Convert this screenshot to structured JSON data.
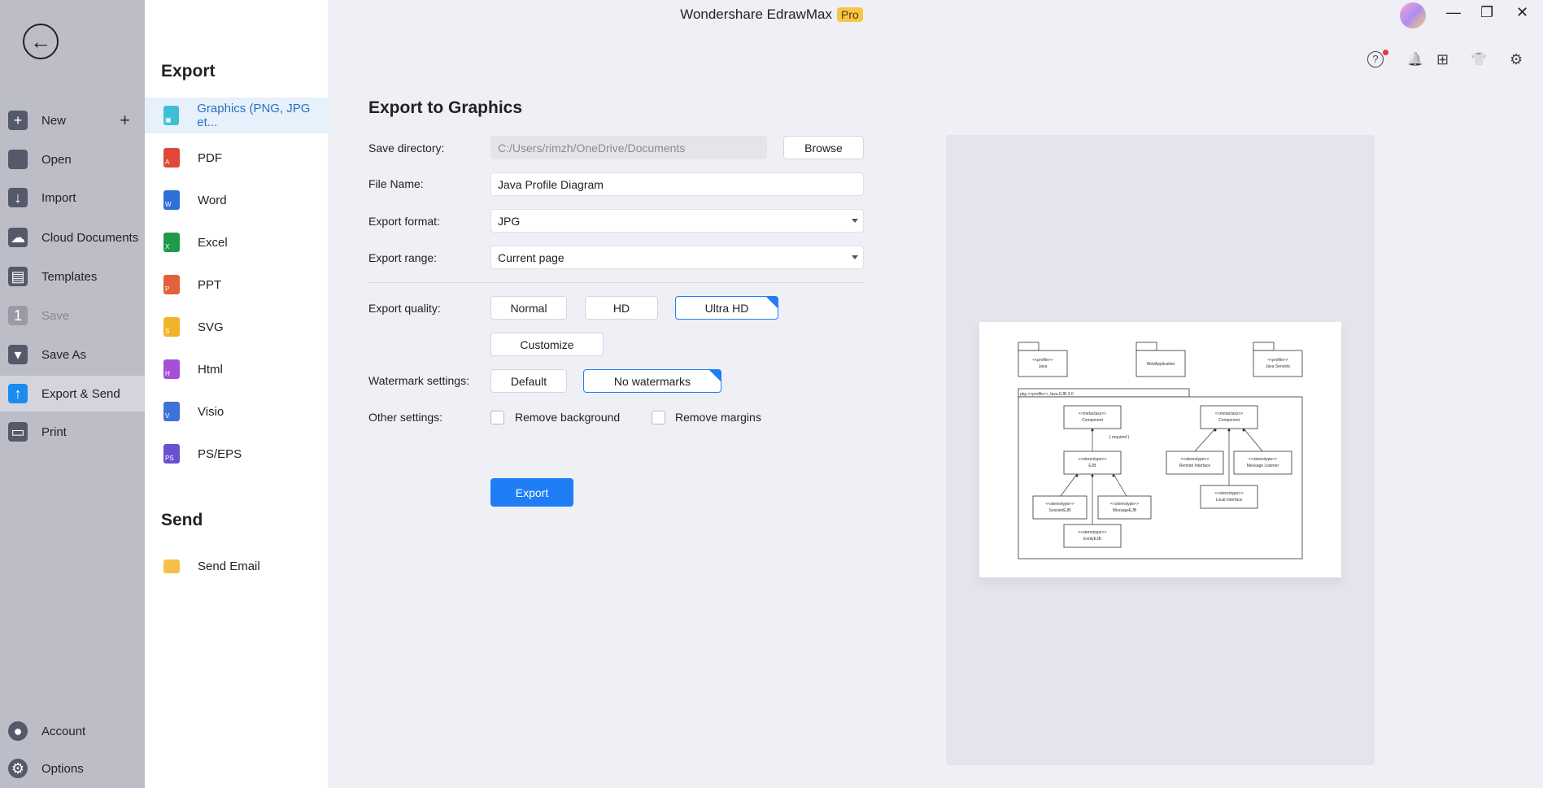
{
  "window": {
    "title": "Wondershare EdrawMax",
    "badge": "Pro",
    "minimize": "—",
    "restore": "❐",
    "close": "✕"
  },
  "toolbar": {
    "help": "?",
    "bell": "🔔",
    "apps": "⊞",
    "theme": "👕",
    "settings": "⚙"
  },
  "sidebar": {
    "items": [
      {
        "label": "New",
        "icon": "new-icon",
        "glyph": "+"
      },
      {
        "label": "Open",
        "icon": "folder-icon",
        "glyph": ""
      },
      {
        "label": "Import",
        "icon": "import-icon",
        "glyph": "↓"
      },
      {
        "label": "Cloud Documents",
        "icon": "cloud-icon",
        "glyph": "☁"
      },
      {
        "label": "Templates",
        "icon": "templates-icon",
        "glyph": "▤"
      },
      {
        "label": "Save",
        "icon": "save-icon",
        "glyph": "1"
      },
      {
        "label": "Save As",
        "icon": "save-as-icon",
        "glyph": "▾"
      },
      {
        "label": "Export & Send",
        "icon": "export-icon",
        "glyph": "↑"
      },
      {
        "label": "Print",
        "icon": "print-icon",
        "glyph": "▭"
      }
    ],
    "bottom": [
      {
        "label": "Account",
        "icon": "account-icon",
        "glyph": "●"
      },
      {
        "label": "Options",
        "icon": "options-icon",
        "glyph": "⚙"
      }
    ]
  },
  "export_panel": {
    "export_heading": "Export",
    "send_heading": "Send",
    "items": [
      {
        "label": "Graphics (PNG, JPG et...",
        "color": "#3cc0d8",
        "tag": "▣"
      },
      {
        "label": "PDF",
        "color": "#e0473a",
        "tag": "A"
      },
      {
        "label": "Word",
        "color": "#2f6fd8",
        "tag": "W"
      },
      {
        "label": "Excel",
        "color": "#1f9a4c",
        "tag": "X"
      },
      {
        "label": "PPT",
        "color": "#e2603a",
        "tag": "P"
      },
      {
        "label": "SVG",
        "color": "#f0b428",
        "tag": "S"
      },
      {
        "label": "Html",
        "color": "#a650d8",
        "tag": "H"
      },
      {
        "label": "Visio",
        "color": "#3d72d8",
        "tag": "V"
      },
      {
        "label": "PS/EPS",
        "color": "#6a50d0",
        "tag": "PS"
      }
    ],
    "send_items": [
      {
        "label": "Send Email",
        "color": "#f5c04a"
      }
    ]
  },
  "form": {
    "title": "Export to Graphics",
    "save_directory_label": "Save directory:",
    "save_directory": "C:/Users/rimzh/OneDrive/Documents",
    "browse": "Browse",
    "file_name_label": "File Name:",
    "file_name": "Java Profile Diagram",
    "format_label": "Export format:",
    "format": "JPG",
    "range_label": "Export range:",
    "range": "Current page",
    "quality_label": "Export quality:",
    "quality_options": [
      "Normal",
      "HD",
      "Ultra HD"
    ],
    "quality_selected": "Ultra HD",
    "customize": "Customize",
    "watermark_label": "Watermark settings:",
    "watermark_options": [
      "Default",
      "No watermarks"
    ],
    "watermark_selected": "No watermarks",
    "other_label": "Other settings:",
    "remove_background": "Remove background",
    "remove_background_checked": false,
    "remove_margins": "Remove margins",
    "remove_margins_checked": false,
    "export_button": "Export",
    "accent": "#1f7ef5"
  },
  "preview": {
    "packages": [
      {
        "stereo": "<<profile>>",
        "name": "Java"
      },
      {
        "stereo": "",
        "name": "WebApplication"
      },
      {
        "stereo": "<<profile>>",
        "name": "Java Servlets"
      }
    ],
    "frame": "pkg <<profile>> Java EJB 3.0",
    "boxes": [
      {
        "s": "<<metaclass>>",
        "n": "Component"
      },
      {
        "s": "<<stereotype>>",
        "n": "EJB"
      },
      {
        "s": "<<stereotype>>",
        "n": "SessionEJB"
      },
      {
        "s": "<<stereotype>>",
        "n": "MessageEJB"
      },
      {
        "s": "<<stereotype>>",
        "n": "EntityEJB"
      },
      {
        "s": "<<metaclass>>",
        "n": "Component"
      },
      {
        "s": "<<stereotype>>",
        "n": "Remote Interface"
      },
      {
        "s": "<<stereotype>>",
        "n": "Message Listener"
      },
      {
        "s": "<<stereotype>>",
        "n": "Local Interface"
      }
    ],
    "constraint": "{ required }"
  }
}
